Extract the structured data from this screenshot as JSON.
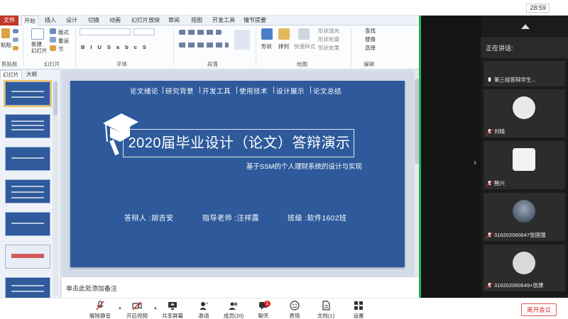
{
  "meeting": {
    "timer": "28:59",
    "leave_label": "离开会议",
    "chat_badge": "1",
    "toolbar": [
      {
        "key": "mute",
        "label": "解除静音"
      },
      {
        "key": "video",
        "label": "开启视频"
      },
      {
        "key": "share",
        "label": "共享屏幕"
      },
      {
        "key": "invite",
        "label": "邀请"
      },
      {
        "key": "members",
        "label": "成员(20)"
      },
      {
        "key": "chat",
        "label": "聊天"
      },
      {
        "key": "reaction",
        "label": "表情"
      },
      {
        "key": "docs",
        "label": "文档(1)"
      },
      {
        "key": "settings",
        "label": "设置"
      }
    ]
  },
  "video_panel": {
    "speaking_label": "正在讲话:",
    "tiles": [
      {
        "name": "第三组答辩学生..."
      },
      {
        "name": "刘晴"
      },
      {
        "name": "鲍兴"
      },
      {
        "name": "316202060647张国强"
      },
      {
        "name": "316202060649+张建"
      }
    ]
  },
  "ppt": {
    "tabs": [
      "文件",
      "开始",
      "插入",
      "设计",
      "切换",
      "动画",
      "幻灯片放映",
      "审阅",
      "视图",
      "开发工具",
      "情节提要"
    ],
    "ribbon": {
      "clipboard_group": "剪贴板",
      "paste_label": "粘贴",
      "slides_group": "幻灯片",
      "new_slide_label": "新建\n幻灯片",
      "layout_label": "版式",
      "reset_label": "重设",
      "section_label": "节",
      "font_group": "字体",
      "paragraph_group": "段落",
      "drawing_group": "绘图",
      "shape_label": "形状",
      "arrange_label": "排列",
      "quickstyle_label": "快速样式",
      "fill_label": "形状填充",
      "outline_label": "形状轮廓",
      "effect_label": "形状效果",
      "editing_group": "编辑",
      "find_label": "查找",
      "replace_label": "替换",
      "select_label": "选择"
    },
    "panel_tabs": [
      "幻灯片",
      "大纲"
    ],
    "notes_placeholder": "单击此处添加备注",
    "slide": {
      "nav": [
        "论文绪论",
        "研究背景",
        "开发工具",
        "使用技术",
        "设计展示",
        "论文总结"
      ],
      "title": "2020届毕业设计（论文）答辩演示",
      "subtitle": "基于SSM的个人理财系统的设计与实现",
      "presenter": "答辩人 :胡吉安",
      "advisor": "指导老师 :汪祥露",
      "class": "班级 :软件1602班"
    }
  },
  "colors": {
    "slide_blue": "#2e5a9c",
    "leave_red": "#e02424",
    "active_green": "#23b35a"
  }
}
